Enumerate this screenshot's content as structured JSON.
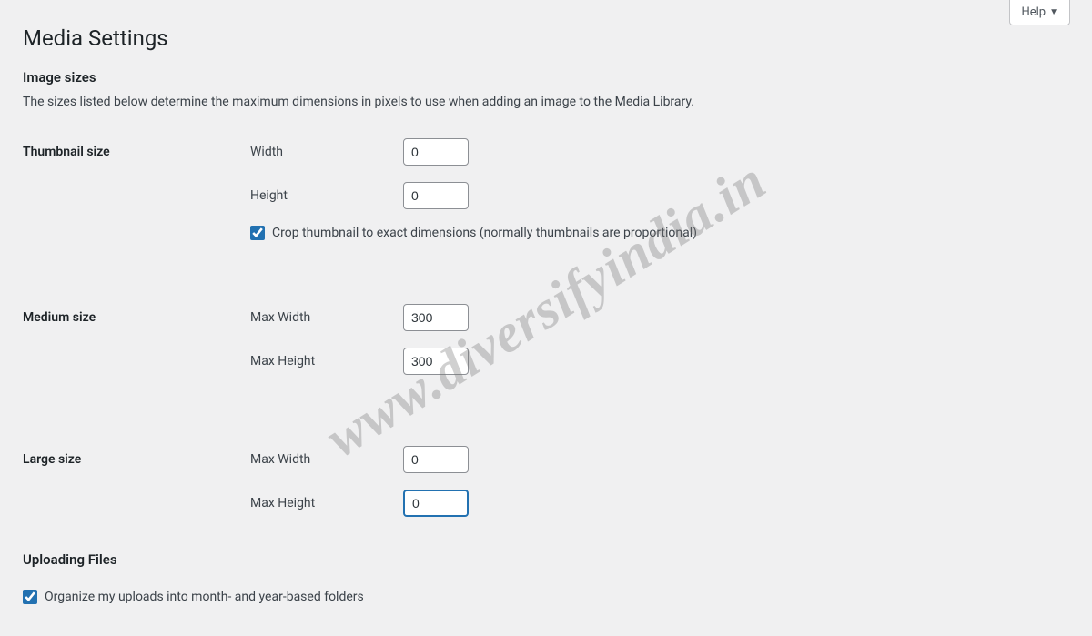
{
  "help": {
    "label": "Help"
  },
  "page_title": "Media Settings",
  "image_sizes": {
    "heading": "Image sizes",
    "description": "The sizes listed below determine the maximum dimensions in pixels to use when adding an image to the Media Library.",
    "thumbnail": {
      "label": "Thumbnail size",
      "width_label": "Width",
      "width_value": "0",
      "height_label": "Height",
      "height_value": "0",
      "crop_label": "Crop thumbnail to exact dimensions (normally thumbnails are proportional)",
      "crop_checked": true
    },
    "medium": {
      "label": "Medium size",
      "max_width_label": "Max Width",
      "max_width_value": "300",
      "max_height_label": "Max Height",
      "max_height_value": "300"
    },
    "large": {
      "label": "Large size",
      "max_width_label": "Max Width",
      "max_width_value": "0",
      "max_height_label": "Max Height",
      "max_height_value": "0"
    }
  },
  "uploading": {
    "heading": "Uploading Files",
    "organize_label": "Organize my uploads into month- and year-based folders",
    "organize_checked": true
  },
  "watermark": "www.diversifyindia.in"
}
